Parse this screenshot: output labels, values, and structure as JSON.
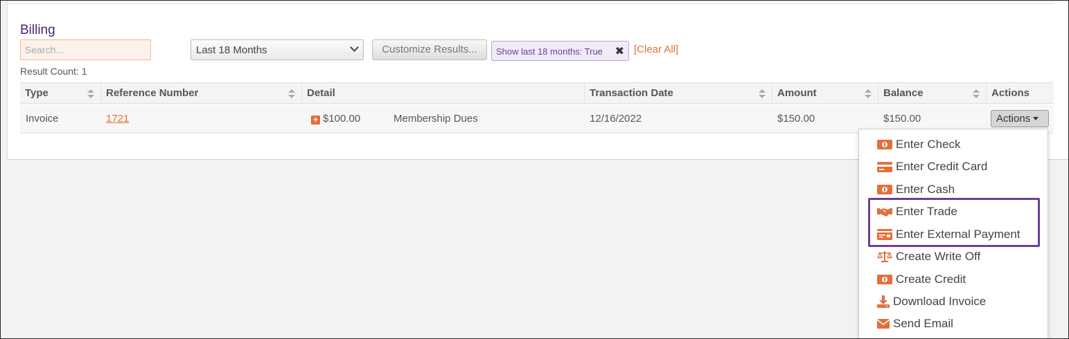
{
  "section": {
    "title": "Billing"
  },
  "toolbar": {
    "search_placeholder": "Search...",
    "period_select": "Last 18 Months",
    "customize_label": "Customize Results...",
    "filter_chip": "Show last 18 months: True",
    "filter_chip_remove": "✖",
    "clear_all": "[Clear All]"
  },
  "result_count": "Result Count: 1",
  "table": {
    "columns": [
      "Type",
      "Reference Number",
      "Detail",
      "Transaction Date",
      "Amount",
      "Balance",
      "Actions"
    ],
    "rows": [
      {
        "type": "Invoice",
        "reference": "1721",
        "detail_amount": "$100.00",
        "detail_desc": "Membership Dues",
        "date": "12/16/2022",
        "amount": "$150.00",
        "balance": "$150.00",
        "actions_label": "Actions"
      }
    ]
  },
  "actions_menu": [
    {
      "label": "Enter Check",
      "icon": "money-bill-icon"
    },
    {
      "label": "Enter Credit Card",
      "icon": "credit-card-icon"
    },
    {
      "label": "Enter Cash",
      "icon": "money-bill-icon"
    },
    {
      "label": "Enter Trade",
      "icon": "handshake-icon"
    },
    {
      "label": "Enter External Payment",
      "icon": "card-icon"
    },
    {
      "label": "Create Write Off",
      "icon": "balance-scale-icon"
    },
    {
      "label": "Create Credit",
      "icon": "money-bill-icon"
    },
    {
      "label": "Download Invoice",
      "icon": "download-icon"
    },
    {
      "label": "Send Email",
      "icon": "envelope-icon"
    }
  ],
  "colors": {
    "accent": "#e2703a",
    "title": "#4b1f6f",
    "highlight": "#6b3f99"
  }
}
